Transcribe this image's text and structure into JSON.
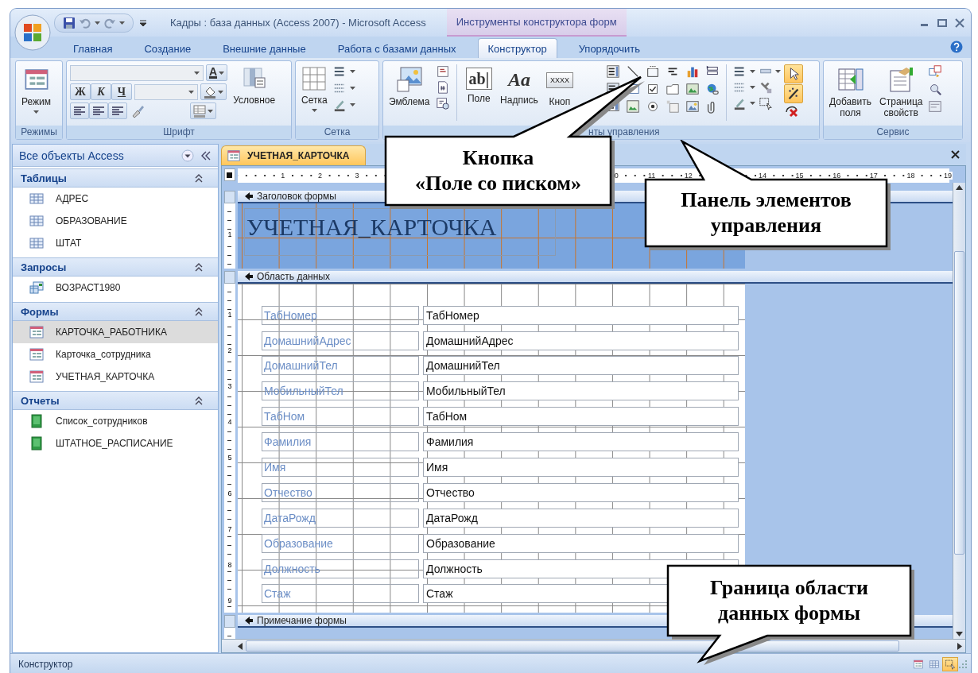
{
  "window": {
    "title": "Кадры : база данных (Access 2007) - Microsoft Access",
    "context_title": "Инструменты конструктора форм"
  },
  "ribbon_tabs": [
    {
      "label": "Главная",
      "selected": false
    },
    {
      "label": "Создание",
      "selected": false
    },
    {
      "label": "Внешние данные",
      "selected": false
    },
    {
      "label": "Работа с базами данных",
      "selected": false
    },
    {
      "label": "Конструктор",
      "selected": true
    },
    {
      "label": "Упорядочить",
      "selected": false
    }
  ],
  "ribbon": {
    "views": {
      "group": "Режимы",
      "button": "Режим"
    },
    "font": {
      "group": "Шрифт",
      "bold": "Ж",
      "italic": "К",
      "underline": "Ч",
      "font_color": "A",
      "conditional": "Условное"
    },
    "gridlines": {
      "group": "Сетка",
      "button": "Сетка"
    },
    "controls": {
      "group": "нты управления",
      "logo": "Эмблема",
      "text_box_glyph": "ab|",
      "text_box": "Поле",
      "label_glyph": "Aa",
      "label": "Надпись",
      "button_glyph": "XXXX",
      "button": "Кноп",
      "select_on": true,
      "wizards_on": true
    },
    "tools": {
      "group": "Сервис",
      "add_fields": "Добавить\nполя",
      "property_sheet": "Страница\nсвойств"
    }
  },
  "navigation": {
    "title": "Все объекты Access",
    "groups": [
      {
        "label": "Таблицы",
        "expanded": true,
        "items": [
          {
            "label": "АДРЕС",
            "kind": "table",
            "selected": false
          },
          {
            "label": "ОБРАЗОВАНИЕ",
            "kind": "table",
            "selected": false
          },
          {
            "label": "ШТАТ",
            "kind": "table",
            "selected": false
          }
        ]
      },
      {
        "label": "Запросы",
        "expanded": true,
        "items": [
          {
            "label": "ВОЗРАСТ1980",
            "kind": "query",
            "selected": false
          }
        ]
      },
      {
        "label": "Формы",
        "expanded": true,
        "items": [
          {
            "label": "КАРТОЧКА_РАБОТНИКА",
            "kind": "form",
            "selected": true
          },
          {
            "label": "Карточка_сотрудника",
            "kind": "form",
            "selected": false
          },
          {
            "label": "УЧЕТНАЯ_КАРТОЧКА",
            "kind": "form",
            "selected": false
          }
        ]
      },
      {
        "label": "Отчеты",
        "expanded": true,
        "items": [
          {
            "label": "Список_сотрудников",
            "kind": "report",
            "selected": false
          },
          {
            "label": "ШТАТНОЕ_РАСПИСАНИЕ",
            "kind": "report",
            "selected": false
          }
        ]
      }
    ]
  },
  "document": {
    "tab": "УЧЕТНАЯ_КАРТОЧКА",
    "ruler_segments": [
      [
        "1",
        "2",
        "3"
      ],
      [
        "0",
        "11",
        "12"
      ],
      [
        "14",
        "15",
        "16",
        "17",
        "18",
        "19"
      ]
    ],
    "sections": [
      {
        "kind": "header",
        "title": "Заголовок формы",
        "ruler": [
          "1"
        ],
        "caption": "УЧЕТНАЯ_КАРТОЧКА"
      },
      {
        "kind": "detail",
        "title": "Область данных",
        "ruler": [
          "1",
          "2",
          "3",
          "4",
          "5",
          "6",
          "7",
          "8",
          "9"
        ],
        "fields": [
          {
            "label": "ТабНомер",
            "value": "ТабНомер"
          },
          {
            "label": "ДомашнийАдрес",
            "value": "ДомашнийАдрес"
          },
          {
            "label": "ДомашнийТел",
            "value": "ДомашнийТел"
          },
          {
            "label": "МобильныйТел",
            "value": "МобильныйТел"
          },
          {
            "label": "ТабНом",
            "value": "ТабНом"
          },
          {
            "label": "Фамилия",
            "value": "Фамилия"
          },
          {
            "label": "Имя",
            "value": "Имя"
          },
          {
            "label": "Отчество",
            "value": "Отчество"
          },
          {
            "label": "ДатаРожд",
            "value": "ДатаРожд"
          },
          {
            "label": "Образование",
            "value": "Образование"
          },
          {
            "label": "Должность",
            "value": "Должность"
          },
          {
            "label": "Стаж",
            "value": "Стаж"
          }
        ]
      },
      {
        "kind": "footer",
        "title": "Примечание формы"
      }
    ]
  },
  "status": {
    "text": "Конструктор",
    "views": [
      {
        "selected": false
      },
      {
        "selected": false
      },
      {
        "selected": true
      }
    ]
  },
  "callouts": [
    {
      "text": "Кнопка\n«Поле со писком»"
    },
    {
      "text": "Панель элементов\nуправления"
    },
    {
      "text": "Граница области\nданных формы"
    }
  ]
}
